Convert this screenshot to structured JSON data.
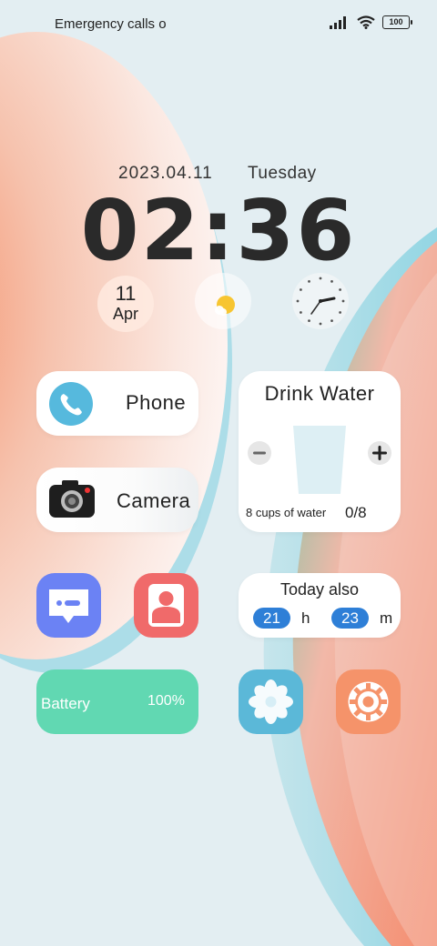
{
  "status_bar": {
    "carrier_text": "Emergency calls o",
    "battery_level": "100",
    "icons": [
      "signal-icon",
      "wifi-icon",
      "battery-icon"
    ]
  },
  "lockscreen": {
    "date": "2023.04.11",
    "weekday": "Tuesday",
    "time": "02:36"
  },
  "calendar_widget": {
    "day": "11",
    "month": "Apr"
  },
  "weather_widget": {
    "icon": "sun-cloud-icon"
  },
  "clock_widget": {
    "icon": "analog-clock-icon"
  },
  "phone_app": {
    "label": "Phone",
    "icon": "phone-icon"
  },
  "camera_app": {
    "label": "Camera",
    "icon": "camera-icon"
  },
  "drink_water": {
    "title": "Drink Water",
    "caption": "8 cups of water",
    "count": "0/8"
  },
  "today_widget": {
    "title": "Today also",
    "hours": "21",
    "hours_unit": "h",
    "minutes": "23",
    "minutes_unit": "m"
  },
  "battery_widget": {
    "label": "Battery",
    "percent": "100%"
  },
  "apps": {
    "messages": {
      "icon": "message-icon"
    },
    "contacts": {
      "icon": "contact-icon"
    },
    "gallery": {
      "icon": "flower-icon"
    },
    "settings": {
      "icon": "gear-icon"
    }
  },
  "colors": {
    "background": "#e4eef2",
    "accent_blue": "#2e7fd7",
    "messages": "#6b82f4",
    "contacts": "#f06a6a",
    "gallery": "#5bb8d8",
    "settings": "#f5936a",
    "battery": "#61d8b2"
  }
}
